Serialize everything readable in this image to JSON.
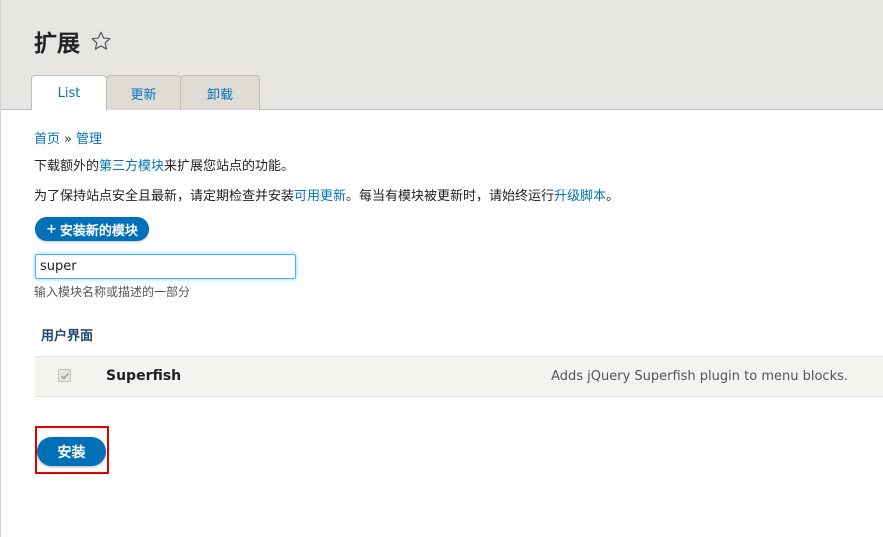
{
  "page": {
    "title": "扩展"
  },
  "tabs": [
    {
      "label": "List",
      "active": true
    },
    {
      "label": "更新",
      "active": false
    },
    {
      "label": "卸载",
      "active": false
    }
  ],
  "breadcrumb": {
    "items": [
      "首页",
      "管理"
    ],
    "separator": "»"
  },
  "intro": {
    "line1_pre": "下载额外的",
    "line1_link": "第三方模块",
    "line1_post": "来扩展您站点的功能。",
    "line2_pre": "为了保持站点安全且最新，请定期检查并安装",
    "line2_link1": "可用更新",
    "line2_mid": "。每当有模块被更新时，请始终运行",
    "line2_link2": "升级脚本",
    "line2_post": "。"
  },
  "add_module_button": {
    "plus": "+",
    "label": "安装新的模块"
  },
  "search": {
    "value": "super",
    "help": "输入模块名称或描述的一部分"
  },
  "group": {
    "label": "用户界面"
  },
  "modules": [
    {
      "name": "Superfish",
      "description": "Adds jQuery Superfish plugin to menu blocks.",
      "checked": true,
      "disabled": true
    }
  ],
  "install_button": {
    "label": "安装"
  },
  "colors": {
    "link": "#0074bd",
    "primary_button": "#0071b8",
    "highlight": "#e00000",
    "header_bg": "#e7e6e2"
  },
  "icons": {
    "favorite": "star-outline-icon",
    "checkbox": "checkmark-icon"
  }
}
